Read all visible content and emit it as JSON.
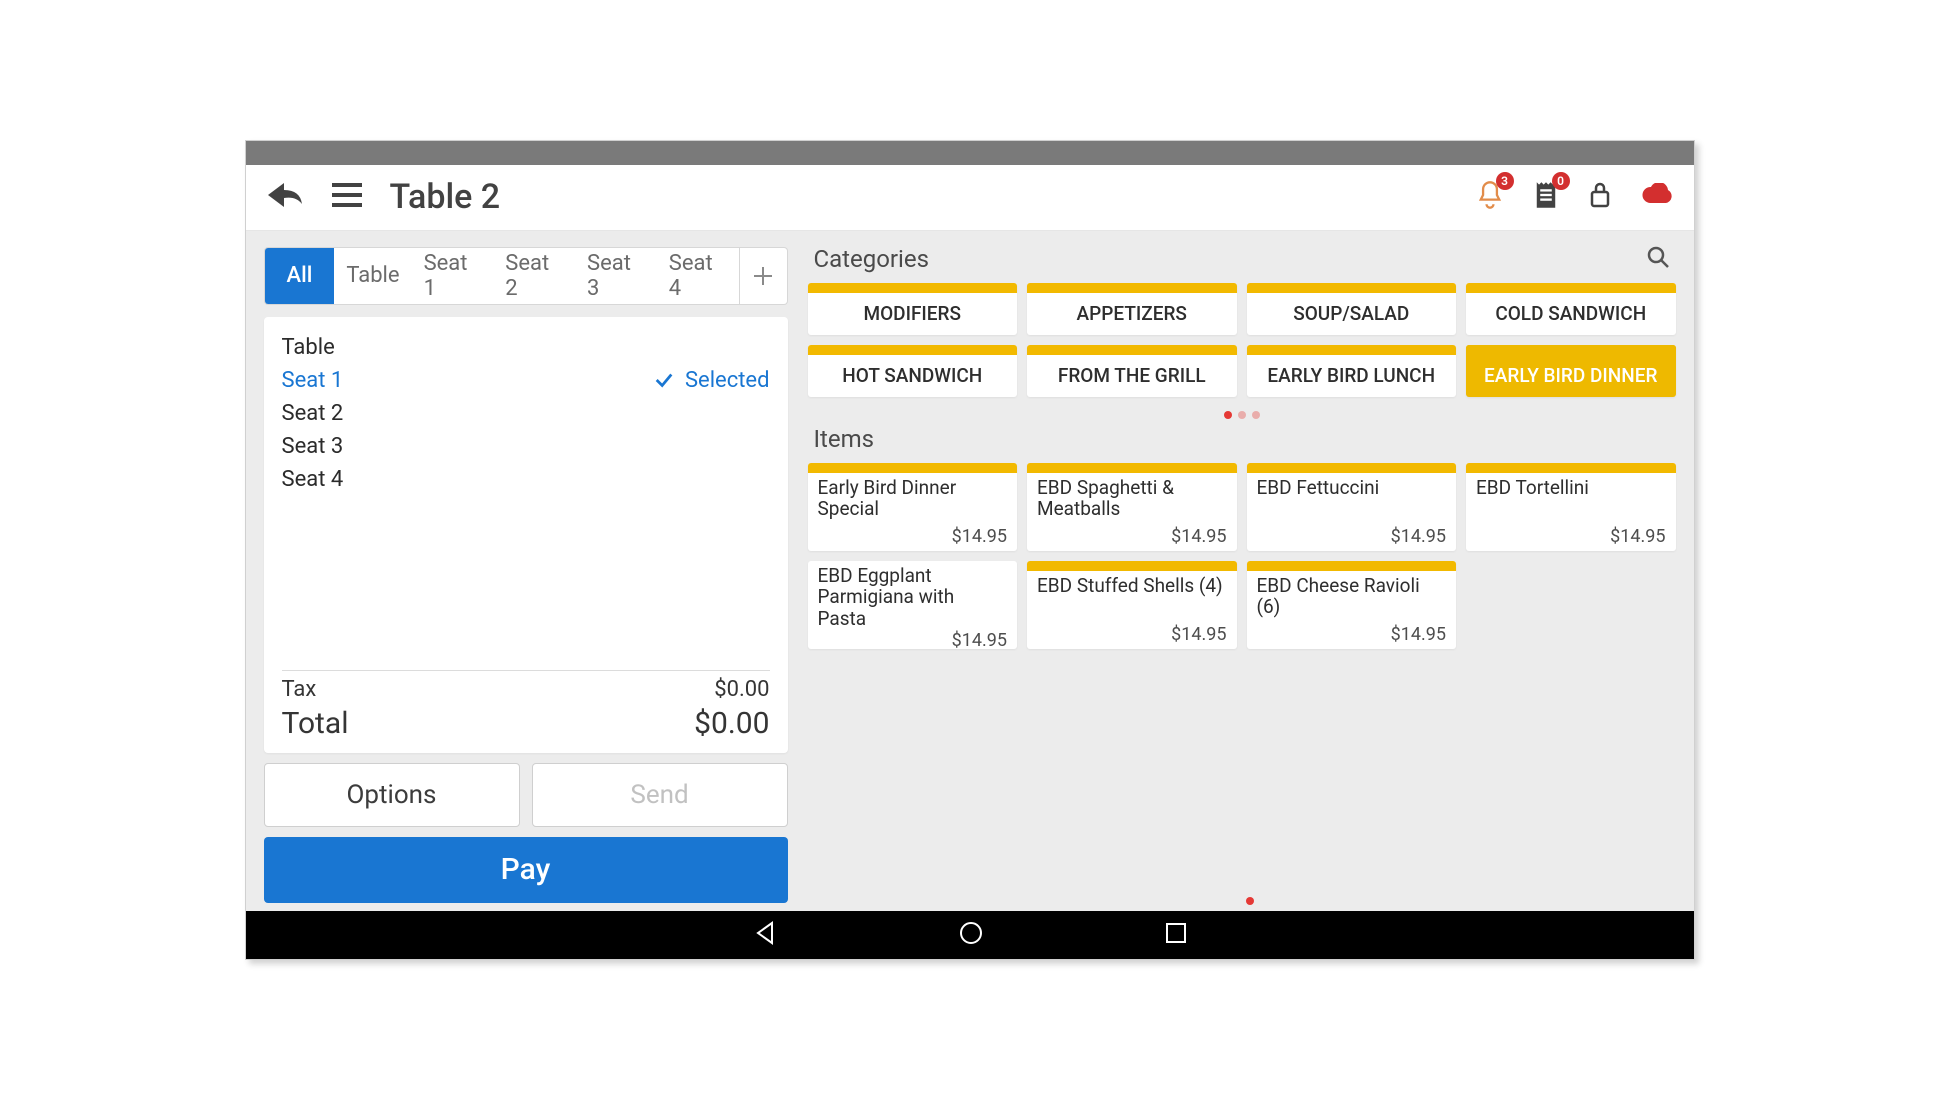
{
  "header": {
    "title": "Table 2",
    "notifications_count": "3",
    "receipts_count": "0"
  },
  "seat_tabs": {
    "all": "All",
    "tabs": [
      "Table",
      "Seat 1",
      "Seat 2",
      "Seat 3",
      "Seat 4"
    ]
  },
  "order": {
    "rows": [
      {
        "label": "Table",
        "selected": false
      },
      {
        "label": "Seat 1",
        "selected": true
      },
      {
        "label": "Seat 2",
        "selected": false
      },
      {
        "label": "Seat 3",
        "selected": false
      },
      {
        "label": "Seat 4",
        "selected": false
      }
    ],
    "selected_text": "Selected",
    "tax_label": "Tax",
    "tax_value": "$0.00",
    "total_label": "Total",
    "total_value": "$0.00"
  },
  "buttons": {
    "options": "Options",
    "send": "Send",
    "pay": "Pay"
  },
  "right": {
    "categories_label": "Categories",
    "items_label": "Items",
    "categories": [
      {
        "label": "MODIFIERS",
        "active": false
      },
      {
        "label": "APPETIZERS",
        "active": false
      },
      {
        "label": "SOUP/SALAD",
        "active": false
      },
      {
        "label": "COLD SANDWICH",
        "active": false
      },
      {
        "label": "HOT SANDWICH",
        "active": false
      },
      {
        "label": "FROM THE GRILL",
        "active": false
      },
      {
        "label": "EARLY BIRD LUNCH",
        "active": false
      },
      {
        "label": "EARLY BIRD DINNER",
        "active": true
      }
    ],
    "items": [
      {
        "name": "Early Bird Dinner Special",
        "price": "$14.95"
      },
      {
        "name": "EBD Spaghetti & Meatballs",
        "price": "$14.95"
      },
      {
        "name": "EBD Fettuccini",
        "price": "$14.95"
      },
      {
        "name": "EBD Tortellini",
        "price": "$14.95"
      },
      {
        "name": "EBD Eggplant Parmigiana with Pasta",
        "price": "$14.95"
      },
      {
        "name": "EBD Stuffed Shells (4)",
        "price": "$14.95"
      },
      {
        "name": "EBD Cheese Ravioli (6)",
        "price": "$14.95"
      }
    ]
  }
}
